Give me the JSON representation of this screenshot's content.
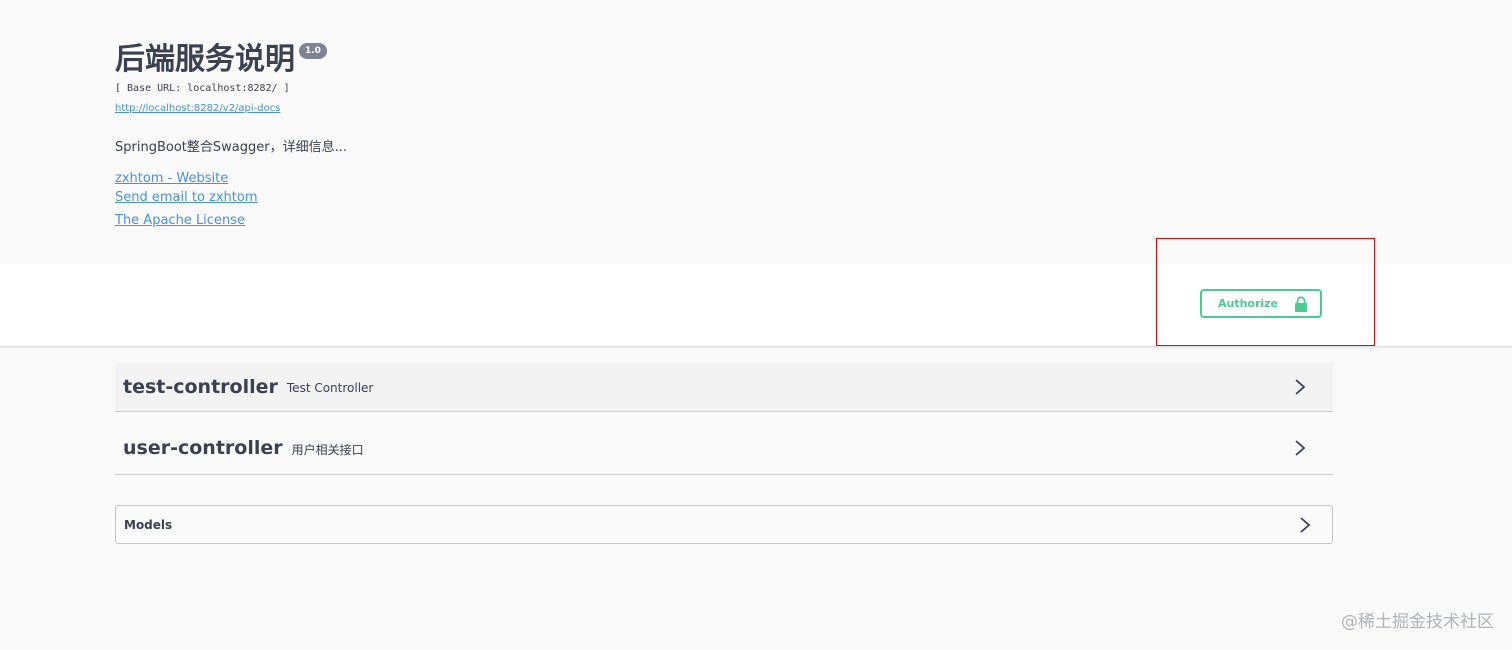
{
  "info": {
    "title": "后端服务说明",
    "version": "1.0",
    "base_url": "[ Base URL: localhost:8282/ ]",
    "api_docs_link": "http://localhost:8282/v2/api-docs",
    "description": "SpringBoot整合Swagger，详细信息...",
    "links": {
      "website": "zxhtom - Website",
      "email": "Send email to zxhtom",
      "license": "The Apache License"
    }
  },
  "auth": {
    "authorize_label": "Authorize",
    "icon": "lock-icon",
    "accent_color": "#49cc90"
  },
  "tags": [
    {
      "name": "test-controller",
      "description": "Test Controller",
      "icon": "chevron-right-icon"
    },
    {
      "name": "user-controller",
      "description": "用户相关接口",
      "icon": "chevron-right-icon"
    }
  ],
  "models": {
    "label": "Models",
    "icon": "chevron-right-icon"
  },
  "watermark": "@稀土掘金技术社区",
  "colors": {
    "highlight": "#ff0000",
    "link": "#4990e2",
    "text": "#3b4151"
  }
}
